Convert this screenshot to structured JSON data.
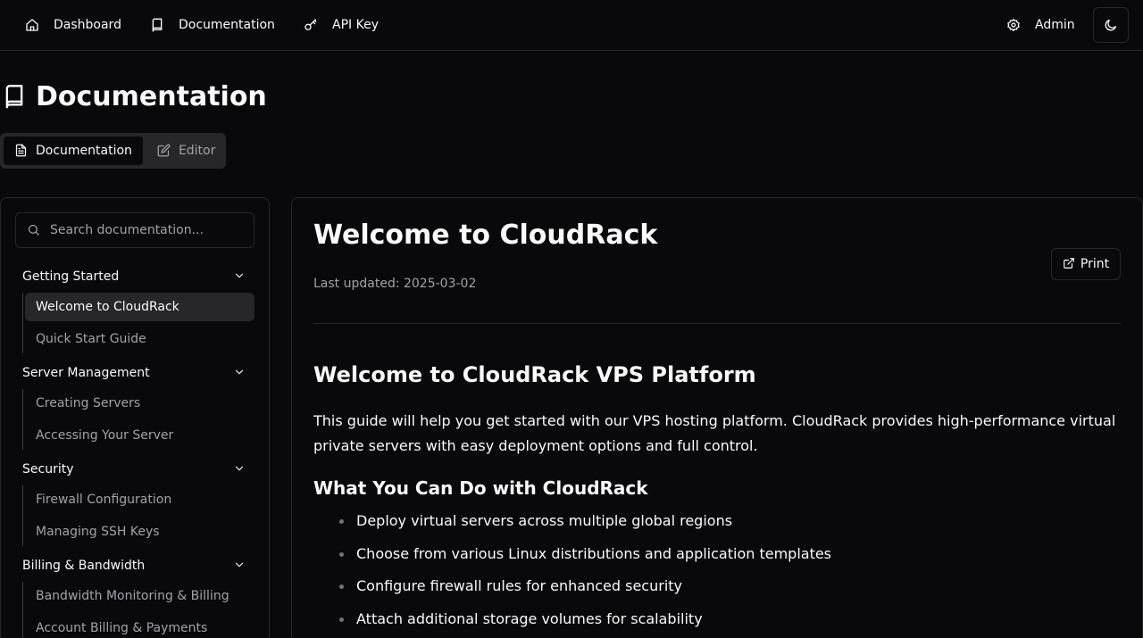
{
  "topnav": {
    "items": [
      {
        "label": "Dashboard",
        "icon": "home-icon"
      },
      {
        "label": "Documentation",
        "icon": "book-icon"
      },
      {
        "label": "API Key",
        "icon": "key-icon"
      }
    ],
    "admin_label": "Admin",
    "theme_icon": "moon-icon"
  },
  "page": {
    "title": "Documentation"
  },
  "tabs": [
    {
      "label": "Documentation",
      "active": true
    },
    {
      "label": "Editor",
      "active": false
    }
  ],
  "sidebar": {
    "search_placeholder": "Search documentation...",
    "sections": [
      {
        "title": "Getting Started",
        "items": [
          {
            "label": "Welcome to CloudRack",
            "active": true
          },
          {
            "label": "Quick Start Guide"
          }
        ]
      },
      {
        "title": "Server Management",
        "items": [
          {
            "label": "Creating Servers"
          },
          {
            "label": "Accessing Your Server"
          }
        ]
      },
      {
        "title": "Security",
        "items": [
          {
            "label": "Firewall Configuration"
          },
          {
            "label": "Managing SSH Keys"
          }
        ]
      },
      {
        "title": "Billing & Bandwidth",
        "items": [
          {
            "label": "Bandwidth Monitoring & Billing"
          },
          {
            "label": "Account Billing & Payments"
          }
        ]
      }
    ]
  },
  "document": {
    "title": "Welcome to CloudRack",
    "last_updated": "Last updated: 2025-03-02",
    "print_label": "Print",
    "heading": "Welcome to CloudRack VPS Platform",
    "intro": "This guide will help you get started with our VPS hosting platform. CloudRack provides high-performance virtual private servers with easy deployment options and full control.",
    "subheading": "What You Can Do with CloudRack",
    "bullets": [
      "Deploy virtual servers across multiple global regions",
      "Choose from various Linux distributions and application templates",
      "Configure firewall rules for enhanced security",
      "Attach additional storage volumes for scalability"
    ]
  }
}
